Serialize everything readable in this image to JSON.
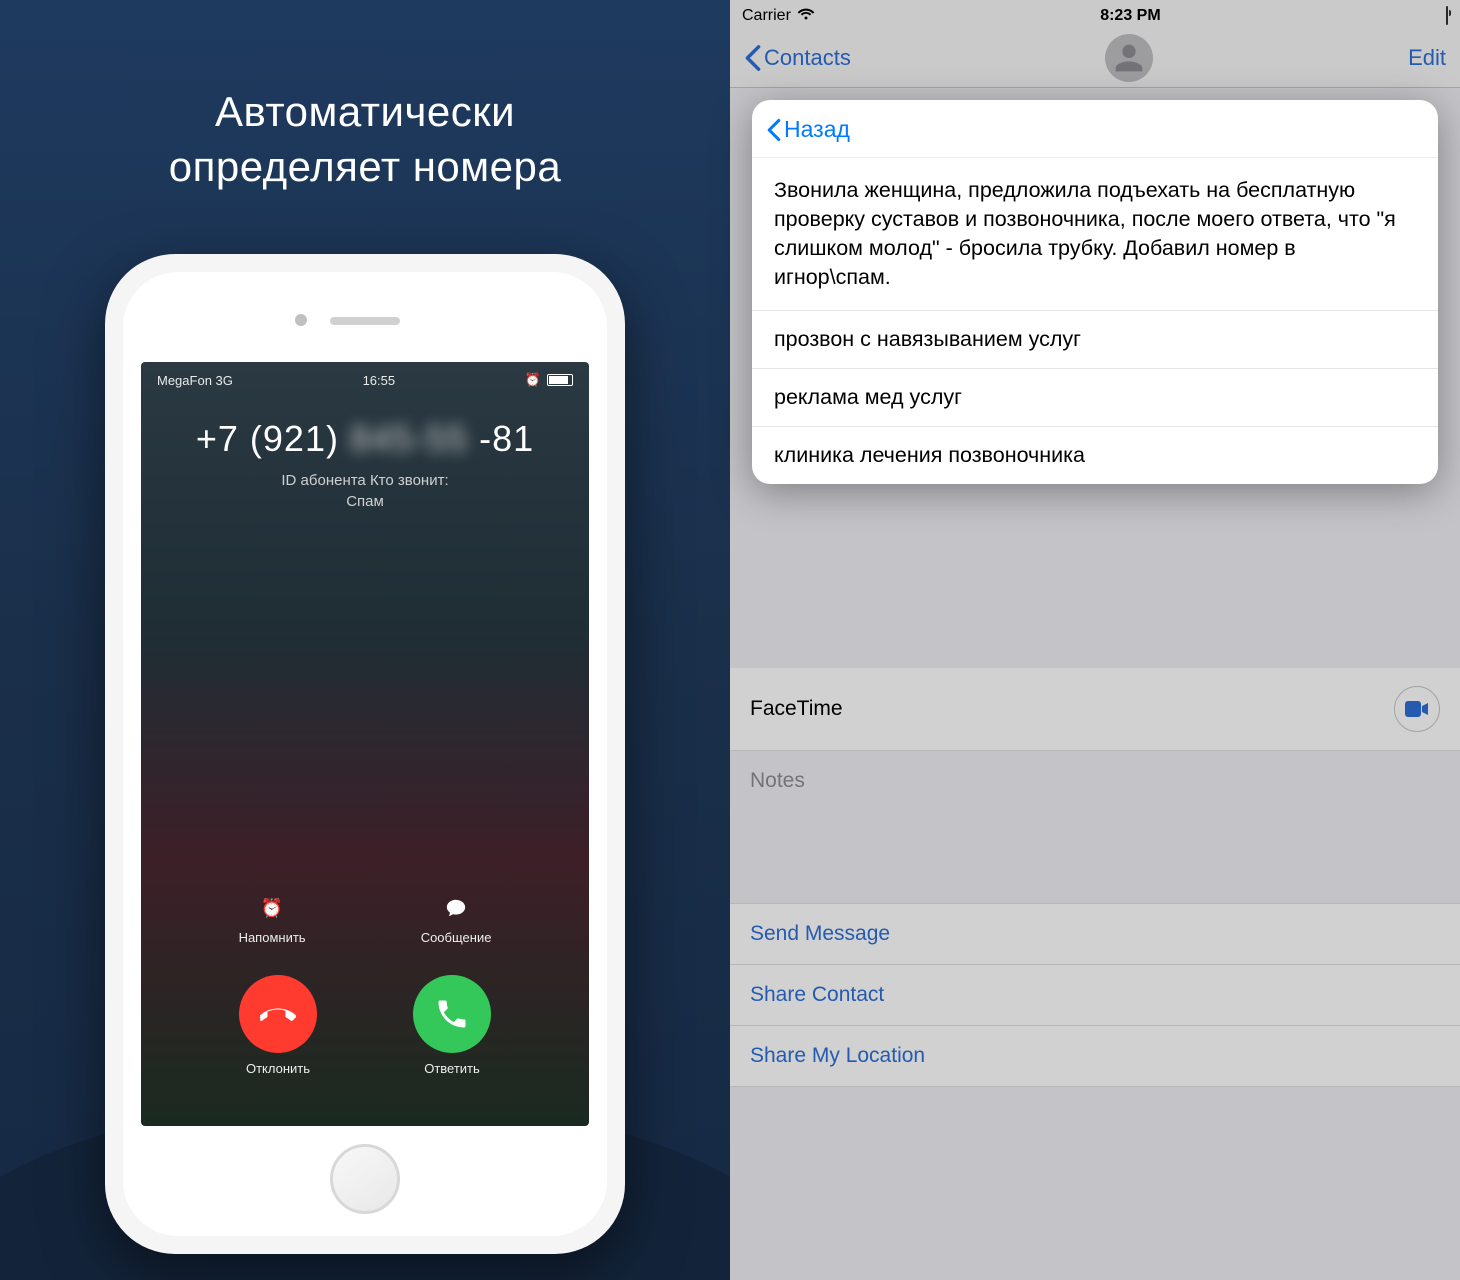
{
  "left": {
    "title_line1": "Автоматически",
    "title_line2": "определяет номера",
    "call": {
      "carrier": "MegaFon  3G",
      "time": "16:55",
      "number_prefix": "+7 (921)",
      "number_mid_blur": "845-55",
      "number_suffix": "-81",
      "id_label_line1": "ID абонента Кто звонит:",
      "id_label_line2": "Спам",
      "remind": "Напомнить",
      "message": "Сообщение",
      "decline": "Отклонить",
      "answer": "Ответить"
    }
  },
  "right": {
    "status": {
      "carrier": "Carrier",
      "time": "8:23 PM"
    },
    "nav": {
      "back": "Contacts",
      "edit": "Edit"
    },
    "rows": {
      "facetime": "FaceTime",
      "notes": "Notes",
      "send_message": "Send Message",
      "share_contact": "Share Contact",
      "share_location": "Share My Location"
    },
    "popup": {
      "back": "Назад",
      "body": "Звонила женщина, предложила подъехать на бесплатную проверку суставов и позвоночника, после моего ответа, что \"я слишком молод\" - бросила трубку. Добавил номер в игнор\\спам.",
      "items": [
        "прозвон с навязыванием услуг",
        "реклама мед услуг",
        "клиника лечения позвоночника"
      ]
    }
  }
}
